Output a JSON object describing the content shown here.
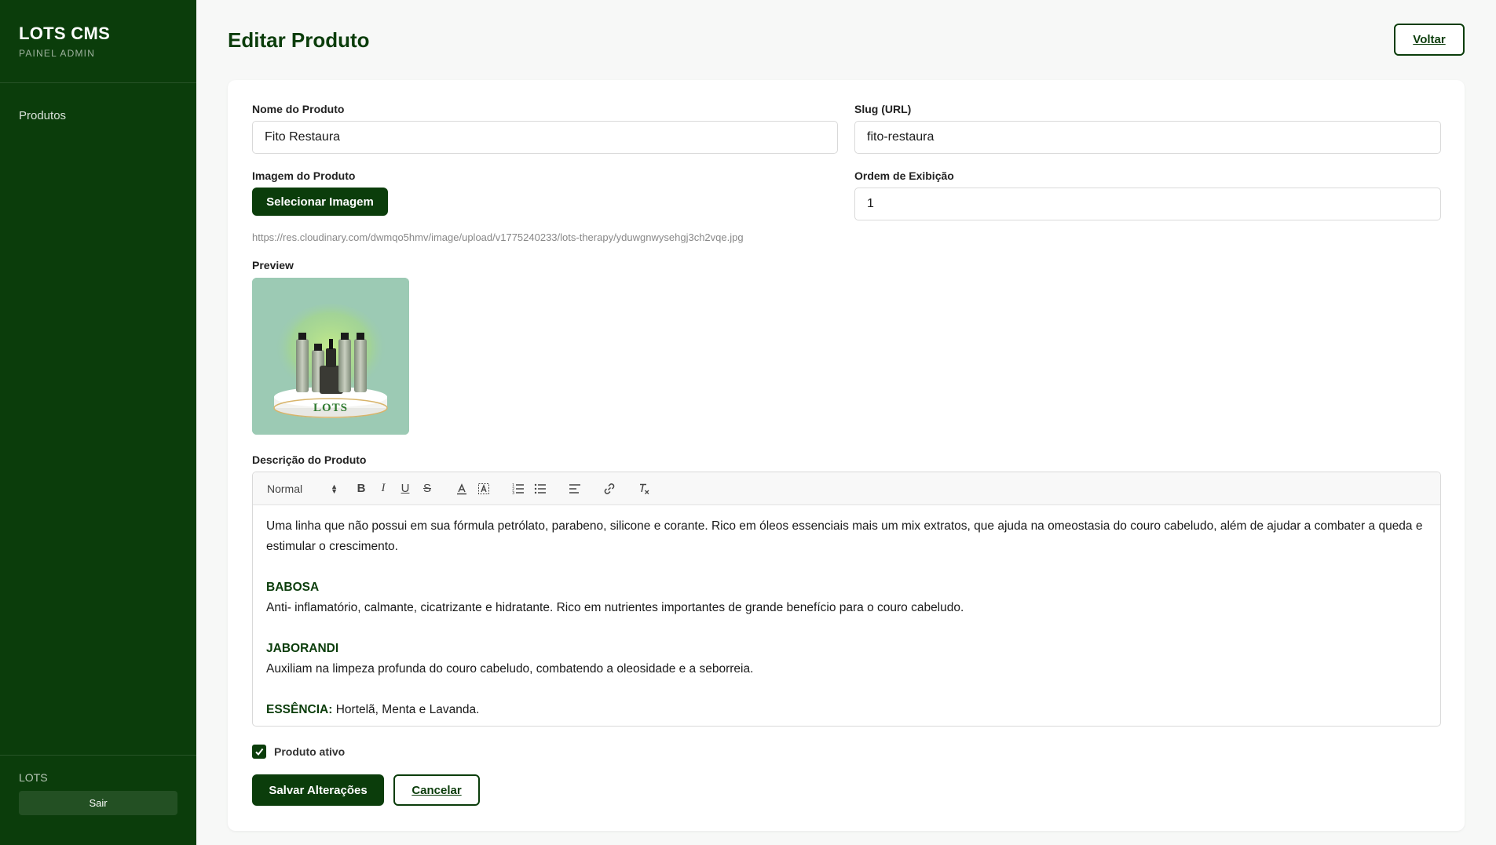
{
  "sidebar": {
    "brand_title": "LOTS CMS",
    "brand_subtitle": "PAINEL ADMIN",
    "items": [
      {
        "label": "Produtos"
      }
    ],
    "user_name": "LOTS",
    "logout_label": "Sair"
  },
  "header": {
    "title": "Editar Produto",
    "back_label": "Voltar"
  },
  "form": {
    "name_label": "Nome do Produto",
    "name_value": "Fito Restaura",
    "slug_label": "Slug (URL)",
    "slug_value": "fito-restaura",
    "image_label": "Imagem do Produto",
    "select_image_label": "Selecionar Imagem",
    "image_url": "https://res.cloudinary.com/dwmqo5hmv/image/upload/v1775240233/lots-therapy/yduwgnwysehgj3ch2vqe.jpg",
    "order_label": "Ordem de Exibição",
    "order_value": "1",
    "preview_label": "Preview",
    "preview_brand": "LOTS",
    "description_label": "Descrição do Produto",
    "toolbar": {
      "format_value": "Normal"
    },
    "description": {
      "intro": "Uma linha que não possui em sua fórmula petrólato, parabeno, silicone e corante. Rico em óleos essenciais mais um mix extratos, que ajuda na omeostasia do couro cabeludo, além de ajudar a combater a queda e estimular o crescimento.",
      "section1_title": "BABOSA",
      "section1_text": "Anti- inflamatório, calmante, cicatrizante e hidratante. Rico em nutrientes importantes de grande benefício para o couro cabeludo.",
      "section2_title": "JABORANDI",
      "section2_text": "Auxiliam na limpeza profunda do couro cabeludo, combatendo a oleosidade e a seborreia.",
      "section3_title": "ESSÊNCIA:",
      "section3_text": " Hortelã, Menta e Lavanda."
    },
    "active_label": "Produto ativo",
    "active_checked": true,
    "save_label": "Salvar Alterações",
    "cancel_label": "Cancelar"
  },
  "colors": {
    "primary": "#0b3d0b",
    "preview_bg": "#9ccab4"
  }
}
